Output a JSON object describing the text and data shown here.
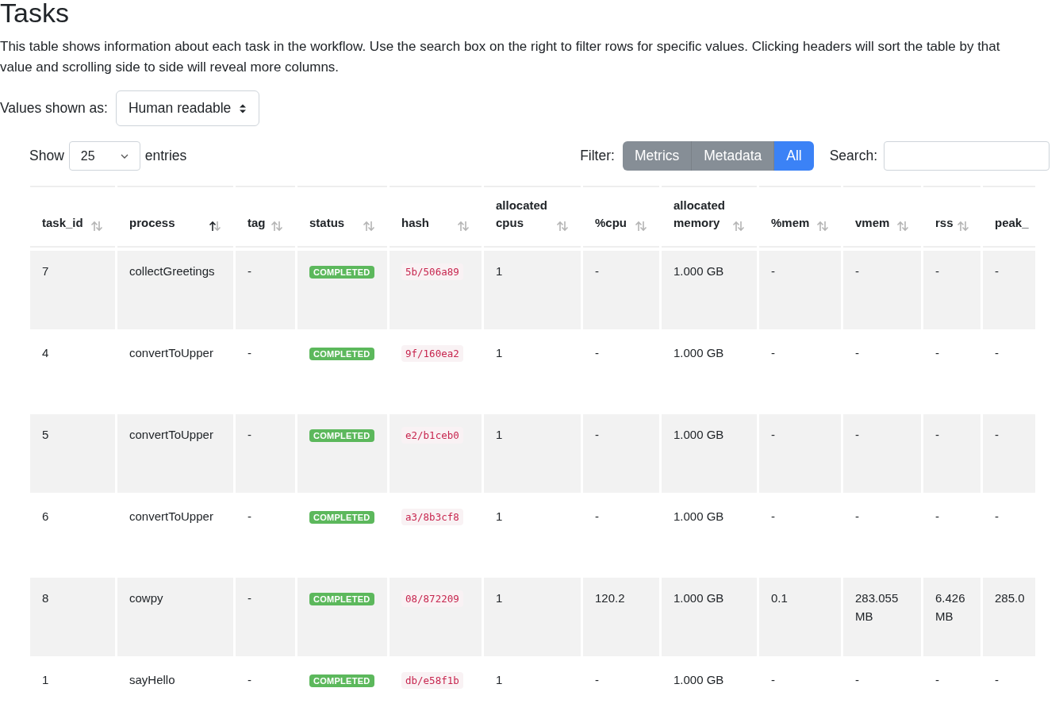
{
  "title": "Tasks",
  "description": "This table shows information about each task in the workflow. Use the search box on the right to filter rows for specific values. Clicking headers will sort the table by that value and scrolling side to side will reveal more columns.",
  "values_shown": {
    "label": "Values shown as:",
    "value": "Human readable"
  },
  "length": {
    "before": "Show",
    "value": "25",
    "after": "entries"
  },
  "filter": {
    "label": "Filter:",
    "buttons": [
      {
        "label": "Metrics",
        "selected": false
      },
      {
        "label": "Metadata",
        "selected": false
      },
      {
        "label": "All",
        "selected": true
      }
    ]
  },
  "search": {
    "label": "Search:"
  },
  "table": {
    "columns": [
      {
        "label": "task_id",
        "sorted_ascending": false
      },
      {
        "label": "process",
        "sorted_ascending": true
      },
      {
        "label": "tag",
        "sorted_ascending": false
      },
      {
        "label": "status",
        "sorted_ascending": false
      },
      {
        "label": "hash",
        "sorted_ascending": false
      },
      {
        "label": "allocated cpus",
        "sorted_ascending": false
      },
      {
        "label": "%cpu",
        "sorted_ascending": false
      },
      {
        "label": "allocated memory",
        "sorted_ascending": false
      },
      {
        "label": "%mem",
        "sorted_ascending": false
      },
      {
        "label": "vmem",
        "sorted_ascending": false
      },
      {
        "label": "rss",
        "sorted_ascending": false
      },
      {
        "label": "peak_"
      }
    ],
    "rows": [
      [
        "7",
        "collectGreetings",
        "-",
        "COMPLETED",
        "5b/506a89",
        "1",
        "-",
        "1.000 GB",
        "-",
        "-",
        "-",
        "-"
      ],
      [
        "4",
        "convertToUpper",
        "-",
        "COMPLETED",
        "9f/160ea2",
        "1",
        "-",
        "1.000 GB",
        "-",
        "-",
        "-",
        "-"
      ],
      [
        "5",
        "convertToUpper",
        "-",
        "COMPLETED",
        "e2/b1ceb0",
        "1",
        "-",
        "1.000 GB",
        "-",
        "-",
        "-",
        "-"
      ],
      [
        "6",
        "convertToUpper",
        "-",
        "COMPLETED",
        "a3/8b3cf8",
        "1",
        "-",
        "1.000 GB",
        "-",
        "-",
        "-",
        "-"
      ],
      [
        "8",
        "cowpy",
        "-",
        "COMPLETED",
        "08/872209",
        "1",
        "120.2",
        "1.000 GB",
        "0.1",
        "283.055 MB",
        "6.426 MB",
        "285.0"
      ],
      [
        "1",
        "sayHello",
        "-",
        "COMPLETED",
        "db/e58f1b",
        "1",
        "-",
        "1.000 GB",
        "-",
        "-",
        "-",
        "-"
      ]
    ]
  }
}
